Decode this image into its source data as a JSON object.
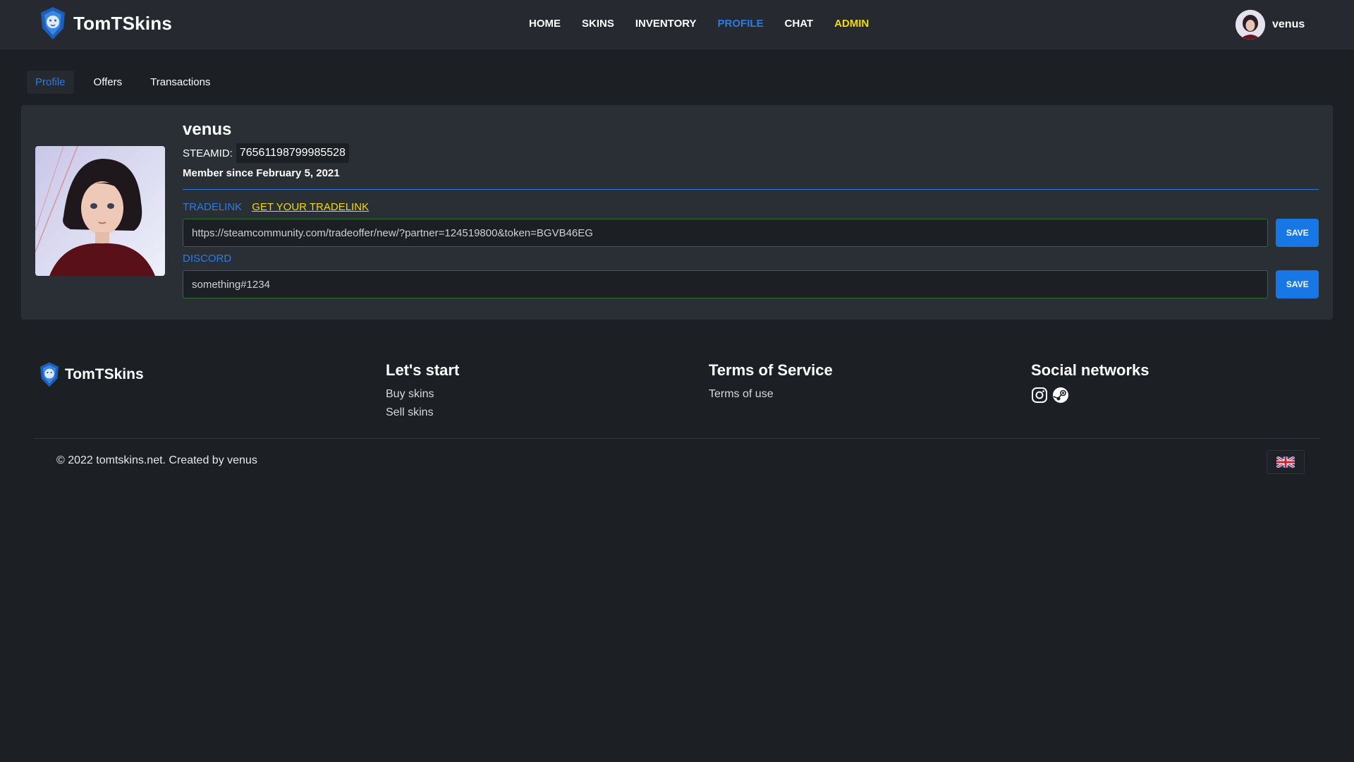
{
  "header": {
    "brand": "TomTSkins",
    "nav": [
      {
        "label": "HOME"
      },
      {
        "label": "SKINS"
      },
      {
        "label": "INVENTORY"
      },
      {
        "label": "PROFILE",
        "active": true
      },
      {
        "label": "CHAT"
      },
      {
        "label": "ADMIN",
        "highlight": "#f1d90b"
      }
    ],
    "user": {
      "name": "venus"
    }
  },
  "tabs": [
    {
      "label": "Profile",
      "active": true
    },
    {
      "label": "Offers"
    },
    {
      "label": "Transactions"
    }
  ],
  "profile": {
    "name": "venus",
    "steamid_label": "STEAMID:",
    "steamid": "76561198799985528",
    "member_since": "Member since February 5, 2021",
    "tradelink_label": "TRADELINK",
    "tradelink_help": "GET YOUR TRADELINK",
    "tradelink_value": "https://steamcommunity.com/tradeoffer/new/?partner=124519800&token=BGVB46EG",
    "discord_label": "DISCORD",
    "discord_value": "something#1234",
    "save_label": "SAVE"
  },
  "footer": {
    "brand": "TomTSkins",
    "col1": {
      "title": "Let's start",
      "links": [
        "Buy skins",
        "Sell skins"
      ]
    },
    "col2": {
      "title": "Terms of Service",
      "links": [
        "Terms of use"
      ]
    },
    "col3": {
      "title": "Social networks",
      "icons": [
        "instagram-icon",
        "steam-icon"
      ]
    },
    "copyright": "© 2022 tomtskins.net. Created by venus",
    "language": "uk-flag-icon"
  },
  "colors": {
    "background": "#1c1f24",
    "header": "#262a30",
    "card": "#2a2e35",
    "accent": "#2d7be5",
    "admin": "#f1d90b",
    "save_button": "#1677e5",
    "input_border": "#2c6e2a"
  }
}
